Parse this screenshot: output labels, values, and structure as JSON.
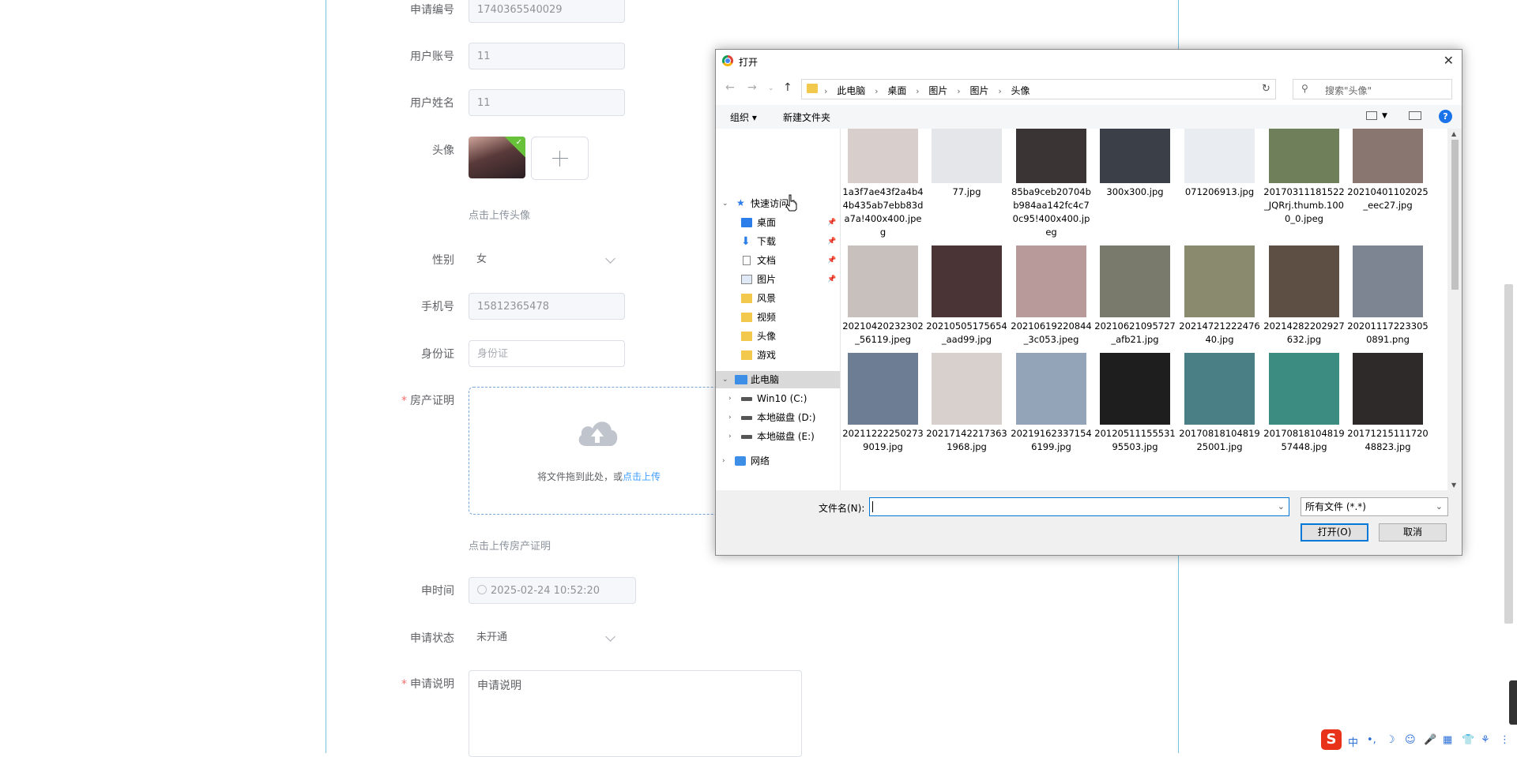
{
  "form": {
    "apply_no": {
      "label": "申请编号",
      "value": "1740365540029"
    },
    "user_account": {
      "label": "用户账号",
      "value": "11"
    },
    "user_name": {
      "label": "用户姓名",
      "value": "11"
    },
    "avatar": {
      "label": "头像",
      "hint": "点击上传头像"
    },
    "gender": {
      "label": "性别",
      "value": "女"
    },
    "phone": {
      "label": "手机号",
      "value": "15812365478"
    },
    "id_card": {
      "label": "身份证",
      "placeholder": "身份证"
    },
    "property_cert": {
      "label": "房产证明",
      "required": "*",
      "drop_text": "将文件拖到此处，或",
      "click_upload": "点击上传",
      "hint": "点击上传房产证明"
    },
    "apply_time": {
      "label": "申时间",
      "value": "2025-02-24 10:52:20"
    },
    "apply_status": {
      "label": "申请状态",
      "value": "未开通"
    },
    "apply_desc": {
      "label": "申请说明",
      "required": "*",
      "placeholder": "申请说明"
    }
  },
  "dialog": {
    "title": "打开",
    "close": "✕",
    "breadcrumb": [
      "此电脑",
      "桌面",
      "图片",
      "图片",
      "头像"
    ],
    "search_placeholder": "搜索\"头像\"",
    "toolbar": {
      "organize": "组织 ▾",
      "new_folder": "新建文件夹",
      "help": "?"
    },
    "nav": {
      "quick_access": "快速访问",
      "items": [
        "桌面",
        "下载",
        "文档",
        "图片",
        "风景",
        "视频",
        "头像",
        "游戏"
      ],
      "this_pc": "此电脑",
      "drives": [
        "Win10 (C:)",
        "本地磁盘 (D:)",
        "本地磁盘 (E:)"
      ],
      "network": "网络"
    },
    "files": [
      {
        "name": "1a3f7ae43f2a4b44b435ab7ebb83da7a!400x400.jpeg",
        "color": "#d8cfcc"
      },
      {
        "name": "77.jpg",
        "color": "#e4e6ea"
      },
      {
        "name": "85ba9ceb20704bb984aa142fc4c70c95!400x400.jpeg",
        "color": "#3a3434"
      },
      {
        "name": "300x300.jpg",
        "color": "#3b3f48"
      },
      {
        "name": "071206913.jpg",
        "color": "#e9edf2"
      },
      {
        "name": "20170311181522_JQRrj.thumb.1000_0.jpeg",
        "color": "#6f7f5a"
      },
      {
        "name": "20210401102025_eec27.jpg",
        "color": "#8a7670"
      },
      {
        "name": "20210420232302_56119.jpeg",
        "color": "#c8c0bd"
      },
      {
        "name": "20210505175654_aad99.jpg",
        "color": "#4a3436"
      },
      {
        "name": "20210619220844_3c053.jpeg",
        "color": "#b89a9a"
      },
      {
        "name": "20210621095727_afb21.jpg",
        "color": "#7a7a6c"
      },
      {
        "name": "20214721222476 40.jpg",
        "color": "#8a8a6e"
      },
      {
        "name": "20214282202927632.jpg",
        "color": "#5e4f45"
      },
      {
        "name": "20201117223305 0891.png",
        "color": "#7d8592"
      },
      {
        "name": "20211222250273 9019.jpg",
        "color": "#6c7d94"
      },
      {
        "name": "20217142217363 1968.jpg",
        "color": "#d7d0cc"
      },
      {
        "name": "20219162337154 6199.jpg",
        "color": "#93a3b8"
      },
      {
        "name": "20120511155531 95503.jpg",
        "color": "#1e1e1e"
      },
      {
        "name": "20170818104819 25001.jpg",
        "color": "#4a7f86"
      },
      {
        "name": "20170818104819 57448.jpg",
        "color": "#3c8c82"
      },
      {
        "name": "20171215111720 48823.jpg",
        "color": "#2e2a2a"
      }
    ],
    "filename_label": "文件名(N):",
    "filename_value": "",
    "file_type": "所有文件 (*.*)",
    "open_button": "打开(O)",
    "cancel_button": "取消"
  },
  "tray": {
    "ime": "S",
    "items": [
      "中",
      "•,",
      "☽",
      "☺",
      "🎤",
      "▦",
      "👕",
      "⚘",
      "⋮"
    ]
  }
}
